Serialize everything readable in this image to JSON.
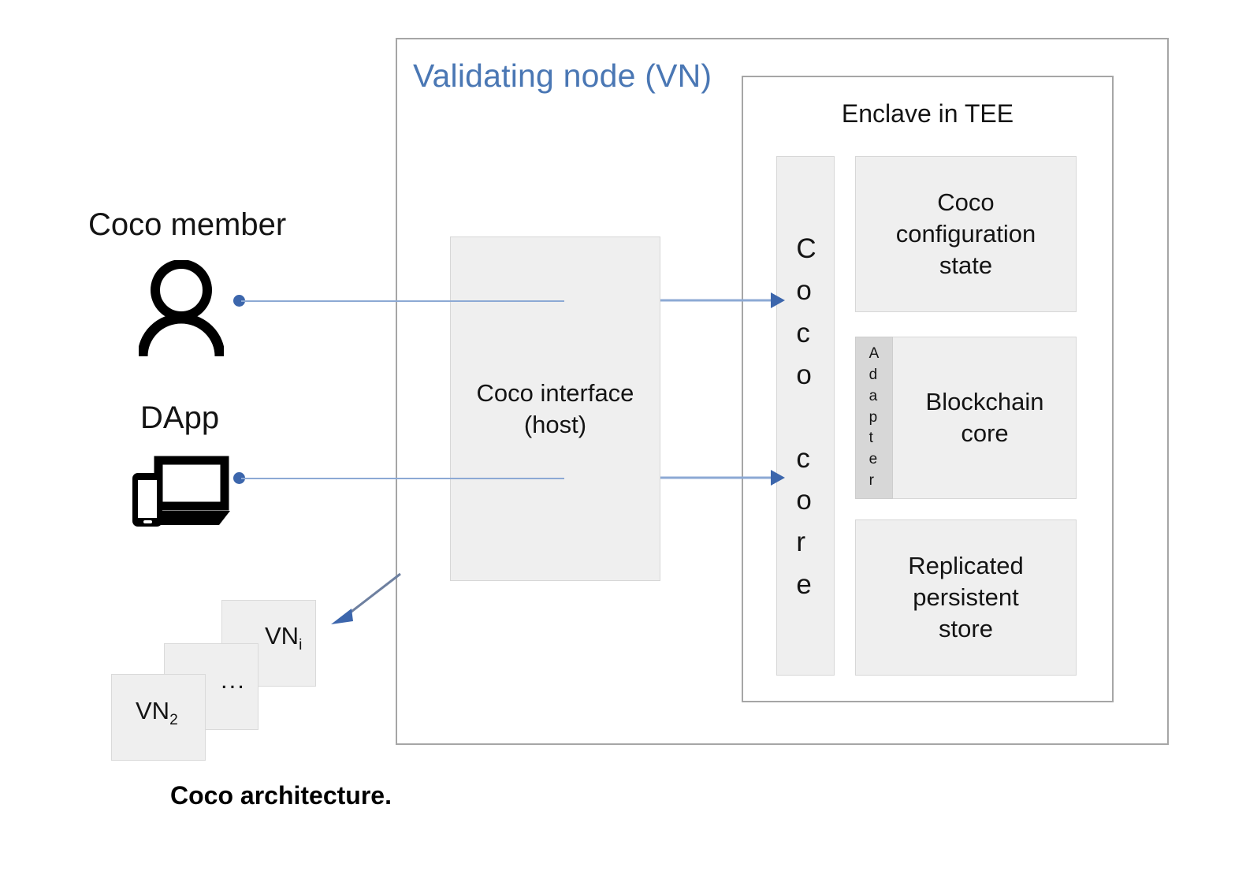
{
  "figure": {
    "caption": "Coco architecture.",
    "accent_blue": "#4a77b4",
    "connector_blue": "#8ca9d4",
    "dot_blue": "#3c66ac",
    "box_fill": "#efefef",
    "box_border": "#d7d7d7",
    "frame_border": "#a6a6a6",
    "adapter_fill": "#d7d7d7"
  },
  "validating_node": {
    "title": "Validating node (VN)"
  },
  "enclave": {
    "title": "Enclave in TEE",
    "coco_core_label": "Coco core",
    "coco_core_stacked": "C\no\nc\no\n \nc\no\nr\ne",
    "boxes": [
      {
        "id": "coco-configuration-state",
        "label": "Coco\nconfiguration\nstate"
      },
      {
        "id": "blockchain-core",
        "label": "Blockchain\ncore"
      },
      {
        "id": "replicated-persistent-store",
        "label": "Replicated\npersistent\nstore"
      }
    ],
    "adapter_label": "Adapter",
    "adapter_stacked": "A\nd\na\np\nt\ne\nr"
  },
  "host": {
    "coco_interface_label": "Coco interface\n(host)"
  },
  "actors": [
    {
      "id": "coco-member",
      "label": "Coco member",
      "icon": "person-icon"
    },
    {
      "id": "dapp",
      "label": "DApp",
      "icon": "devices-icon"
    }
  ],
  "vn_stack": [
    {
      "id": "vn-i",
      "prefix": "VN",
      "subscript": "i"
    },
    {
      "id": "vn-dots",
      "prefix": "...",
      "subscript": ""
    },
    {
      "id": "vn-2",
      "prefix": "VN",
      "subscript": "2"
    }
  ]
}
